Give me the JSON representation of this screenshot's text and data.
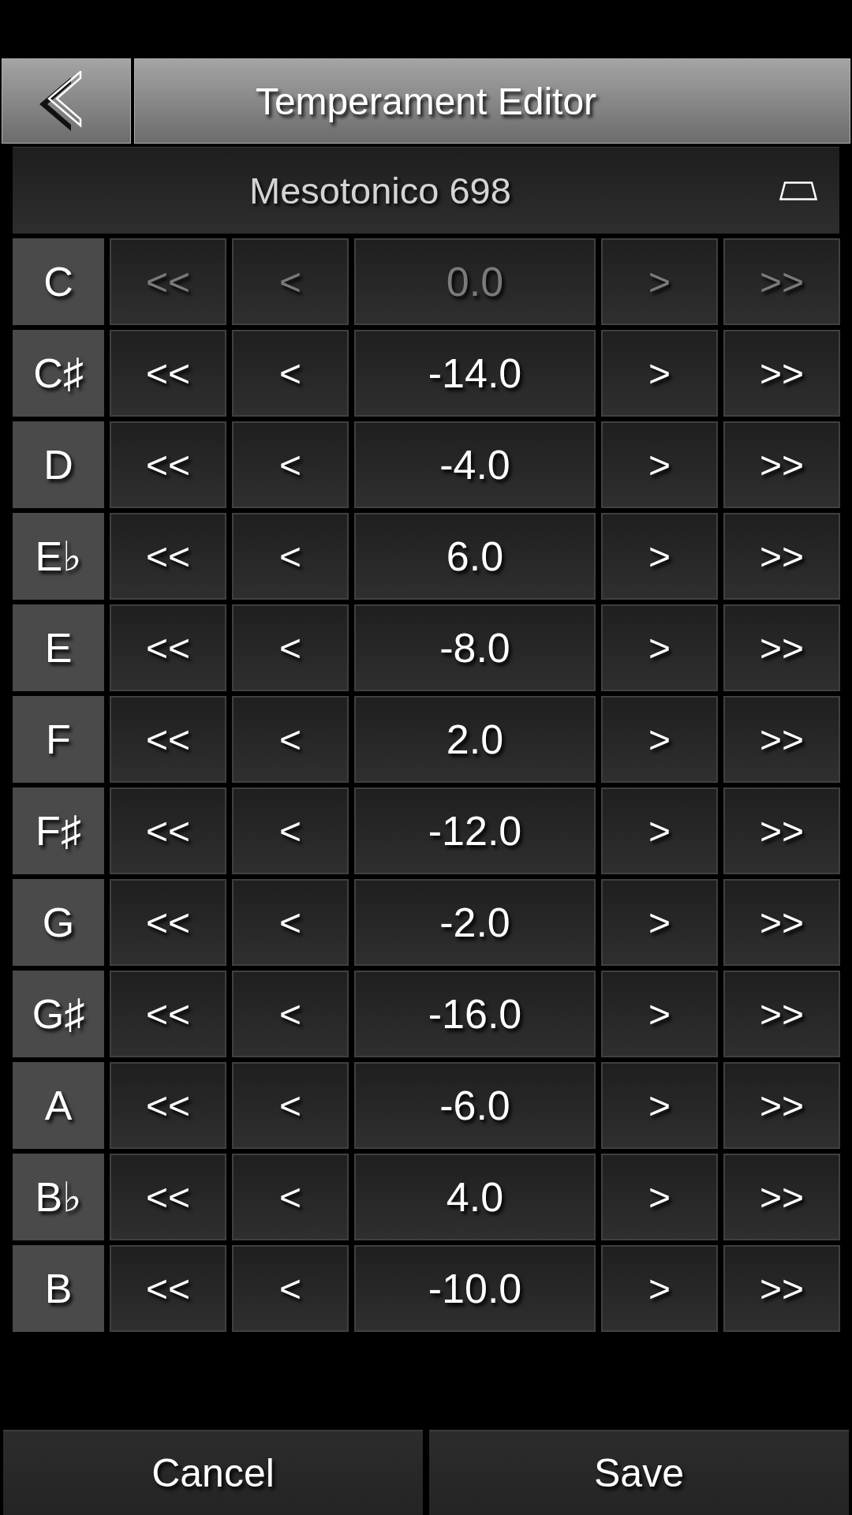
{
  "header": {
    "title": "Temperament Editor"
  },
  "preset": {
    "name": "Mesotonico 698"
  },
  "notes": [
    {
      "note": "C",
      "coarse_down": "<<",
      "fine_down": "<",
      "value": "0.0",
      "fine_up": ">",
      "coarse_up": ">>",
      "disabled": true
    },
    {
      "note": "C♯",
      "coarse_down": "<<",
      "fine_down": "<",
      "value": "-14.0",
      "fine_up": ">",
      "coarse_up": ">>",
      "disabled": false
    },
    {
      "note": "D",
      "coarse_down": "<<",
      "fine_down": "<",
      "value": "-4.0",
      "fine_up": ">",
      "coarse_up": ">>",
      "disabled": false
    },
    {
      "note": "E♭",
      "coarse_down": "<<",
      "fine_down": "<",
      "value": "6.0",
      "fine_up": ">",
      "coarse_up": ">>",
      "disabled": false
    },
    {
      "note": "E",
      "coarse_down": "<<",
      "fine_down": "<",
      "value": "-8.0",
      "fine_up": ">",
      "coarse_up": ">>",
      "disabled": false
    },
    {
      "note": "F",
      "coarse_down": "<<",
      "fine_down": "<",
      "value": "2.0",
      "fine_up": ">",
      "coarse_up": ">>",
      "disabled": false
    },
    {
      "note": "F♯",
      "coarse_down": "<<",
      "fine_down": "<",
      "value": "-12.0",
      "fine_up": ">",
      "coarse_up": ">>",
      "disabled": false
    },
    {
      "note": "G",
      "coarse_down": "<<",
      "fine_down": "<",
      "value": "-2.0",
      "fine_up": ">",
      "coarse_up": ">>",
      "disabled": false
    },
    {
      "note": "G♯",
      "coarse_down": "<<",
      "fine_down": "<",
      "value": "-16.0",
      "fine_up": ">",
      "coarse_up": ">>",
      "disabled": false
    },
    {
      "note": "A",
      "coarse_down": "<<",
      "fine_down": "<",
      "value": "-6.0",
      "fine_up": ">",
      "coarse_up": ">>",
      "disabled": false
    },
    {
      "note": "B♭",
      "coarse_down": "<<",
      "fine_down": "<",
      "value": "4.0",
      "fine_up": ">",
      "coarse_up": ">>",
      "disabled": false
    },
    {
      "note": "B",
      "coarse_down": "<<",
      "fine_down": "<",
      "value": "-10.0",
      "fine_up": ">",
      "coarse_up": ">>",
      "disabled": false
    }
  ],
  "actions": [
    {
      "label": "Cancel"
    },
    {
      "label": "Save"
    }
  ]
}
